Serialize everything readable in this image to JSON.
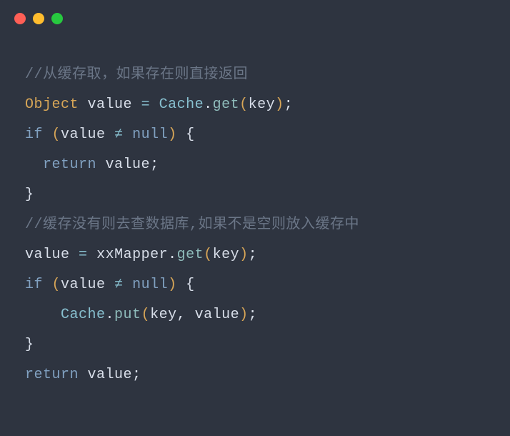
{
  "titlebar": {
    "close": "close",
    "minimize": "minimize",
    "maximize": "maximize"
  },
  "code": {
    "line1": {
      "comment": "//从缓存取，如果存在则直接返回"
    },
    "line2": {
      "type": "Object",
      "sp1": " ",
      "ident": "value",
      "sp2": " ",
      "op": "=",
      "sp3": " ",
      "obj": "Cache",
      "dot": ".",
      "method": "get",
      "lp": "(",
      "arg": "key",
      "rp": ")",
      "semi": ";"
    },
    "line3": {
      "kw": "if",
      "sp1": " ",
      "lp": "(",
      "ident": "value",
      "sp2": " ",
      "ne": "≠",
      "sp3": " ",
      "null": "null",
      "rp": ")",
      "sp4": " ",
      "lb": "{"
    },
    "line4": {
      "indent": "  ",
      "kw": "return",
      "sp1": " ",
      "ident": "value",
      "semi": ";"
    },
    "line5": {
      "rb": "}"
    },
    "line6": {
      "comment": "//缓存没有则去查数据库,如果不是空则放入缓存中"
    },
    "line7": {
      "ident": "value",
      "sp1": " ",
      "op": "=",
      "sp2": " ",
      "obj": "xxMapper",
      "dot": ".",
      "method": "get",
      "lp": "(",
      "arg": "key",
      "rp": ")",
      "semi": ";"
    },
    "line8": {
      "kw": "if",
      "sp1": " ",
      "lp": "(",
      "ident": "value",
      "sp2": " ",
      "ne": "≠",
      "sp3": " ",
      "null": "null",
      "rp": ")",
      "sp4": " ",
      "lb": "{"
    },
    "line9": {
      "indent": "    ",
      "obj": "Cache",
      "dot": ".",
      "method": "put",
      "lp": "(",
      "arg1": "key",
      "comma": ",",
      "sp1": " ",
      "arg2": "value",
      "rp": ")",
      "semi": ";"
    },
    "line10": {
      "rb": "}"
    },
    "line11": {
      "kw": "return",
      "sp1": " ",
      "ident": "value",
      "semi": ";"
    }
  }
}
